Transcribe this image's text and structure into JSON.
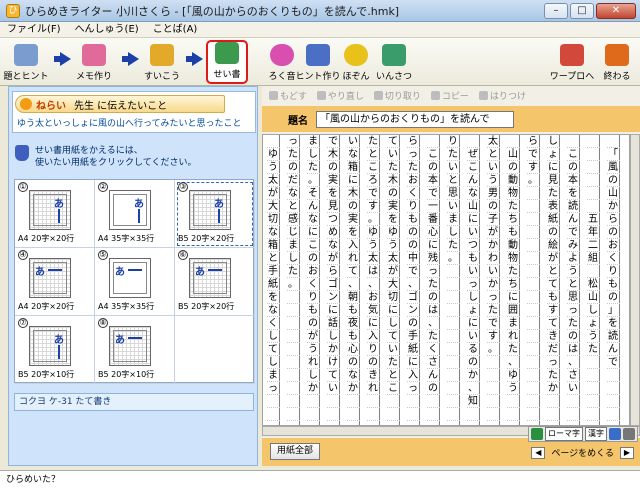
{
  "window": {
    "title": "ひらめきライター 小川さくら - [「風の山からのおくりもの」を読んで.hmk]",
    "min": "–",
    "max": "□",
    "close": "✕"
  },
  "menu": [
    {
      "label": "ファイル(F)"
    },
    {
      "label": "へんしゅう(E)"
    },
    {
      "label": "ことば(A)"
    }
  ],
  "toolbar": {
    "steps": [
      {
        "label": "題とヒント",
        "icon": "title-hint-icon",
        "color": "#7a9ccf"
      },
      {
        "label": "メモ作り",
        "icon": "memo-icon",
        "color": "#e06a9a"
      },
      {
        "label": "すいこう",
        "icon": "revise-icon",
        "color": "#e3a928"
      },
      {
        "label": "せい書",
        "icon": "clean-copy-icon",
        "color": "#3c9a4f"
      }
    ],
    "tools": [
      {
        "label": "ろく音",
        "icon": "record-icon",
        "color": "#d84fb0"
      },
      {
        "label": "ヒント作り",
        "icon": "hint-make-icon",
        "color": "#4b6fc4"
      },
      {
        "label": "ほぞん",
        "icon": "save-icon",
        "color": "#e8c11b"
      },
      {
        "label": "いんさつ",
        "icon": "print-icon",
        "color": "#3a9b6b"
      }
    ],
    "right": [
      {
        "label": "ワープロへ",
        "icon": "word-processor-icon",
        "color": "#d2483a"
      },
      {
        "label": "終わる",
        "icon": "exit-icon",
        "color": "#e06a1c"
      }
    ]
  },
  "goal": {
    "label": "ねらい",
    "title": "先生 に伝えたいこと",
    "text": "ゆう太といっしょに風の山へ行ってみたいと思ったこと"
  },
  "paper_instructions": [
    "せい書用紙をかえるには、",
    "使いたい用紙をクリックしてください。"
  ],
  "papers": [
    {
      "num": "①",
      "label": "A4 20字×20行",
      "ruled": true,
      "dir": "down",
      "glyph": "あ"
    },
    {
      "num": "②",
      "label": "A4 35字×35行",
      "ruled": false,
      "dir": "down",
      "glyph": "あ"
    },
    {
      "num": "③",
      "label": "B5 20字×20行",
      "ruled": true,
      "dir": "down",
      "glyph": "あ",
      "selected": true
    },
    {
      "num": "④",
      "label": "A4 20字×20行",
      "ruled": true,
      "dir": "right",
      "glyph": "あ"
    },
    {
      "num": "⑤",
      "label": "A4 35字×35行",
      "ruled": false,
      "dir": "right",
      "glyph": "あ"
    },
    {
      "num": "⑥",
      "label": "B5 20字×20行",
      "ruled": true,
      "dir": "right",
      "glyph": "あ"
    },
    {
      "num": "⑦",
      "label": "B5 20字×10行",
      "ruled": true,
      "dir": "down",
      "glyph": "あ"
    },
    {
      "num": "⑧",
      "label": "B5 20字×10行",
      "ruled": true,
      "dir": "right",
      "glyph": "あ"
    }
  ],
  "paper_status": "コクヨ ケ-31 たて書き",
  "edit": [
    {
      "label": "もどす"
    },
    {
      "label": "やり直し"
    },
    {
      "label": "切り取り"
    },
    {
      "label": "コピー"
    },
    {
      "label": "はりつけ"
    }
  ],
  "doc_title_label": "題名",
  "doc_title": "「風の山からのおくりもの」を読んで",
  "manuscript_columns": [
    "　「風の山からのおくりもの」を読んで",
    "　　　　　　五年二組　松山しょうた",
    "　この本を読んでみようと思ったのは、さい",
    "しょに見た表紙の絵がとてもすてきだったか",
    "らです。",
    "　山の動物たちも動物たちに囲まれた、ゆう",
    "太という男の子がかわいかったです。",
    "　ぜこんな山にいつもいっしょにいるのか、知",
    "りたいと思いました。",
    "　この本で一番心に残ったのは、たくさんの",
    "らったおくりものの中で、ゴンの手紙に入っ",
    "ていた木の実をゆう太が大切にしていたとこ",
    "たところです。ゆう太は、お気に入りのきれ",
    "いな箱に木の実を入れて、朝も夜も心のなか",
    "で木の実を見つめながらゴンに話しかけてい",
    "ました。そんなにこのおくりものがうれしか",
    "ったのだなと感じました。",
    "　ゆう太が大切な箱と手紙をなくしてしまっ"
  ],
  "bottom": {
    "paper_all": "用紙全部",
    "page_turn": "ページをめくる"
  },
  "ime": {
    "mode": "ローマ字",
    "kanji": "漢字"
  },
  "status": "ひらめいた？"
}
